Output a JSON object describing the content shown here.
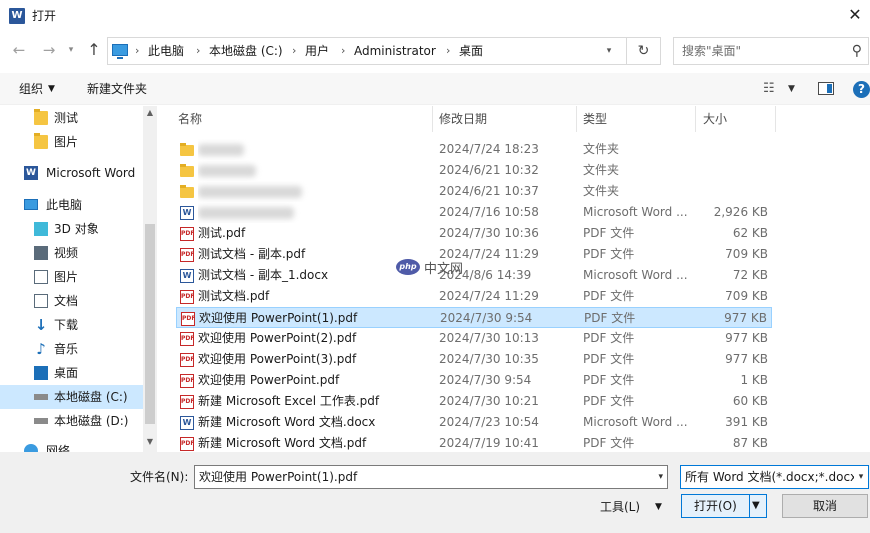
{
  "window": {
    "title": "打开",
    "app_icon": "W"
  },
  "address": {
    "crumbs": [
      "此电脑",
      "本地磁盘 (C:)",
      "用户",
      "Administrator",
      "桌面"
    ],
    "search_placeholder": "搜索\"桌面\""
  },
  "toolbar": {
    "organize_label": "组织",
    "new_folder_label": "新建文件夹"
  },
  "nav": {
    "items": [
      {
        "label": "测试",
        "icon": "folder-icon"
      },
      {
        "label": "图片",
        "icon": "folder-icon"
      },
      {
        "label": "Microsoft Word",
        "icon": "word-icon"
      },
      {
        "label": "此电脑",
        "icon": "computer-icon"
      },
      {
        "label": "3D 对象",
        "icon": "cube-icon"
      },
      {
        "label": "视频",
        "icon": "video-icon"
      },
      {
        "label": "图片",
        "icon": "picture-icon"
      },
      {
        "label": "文档",
        "icon": "document-icon"
      },
      {
        "label": "下载",
        "icon": "download-icon"
      },
      {
        "label": "音乐",
        "icon": "music-icon"
      },
      {
        "label": "桌面",
        "icon": "desktop-icon"
      },
      {
        "label": "本地磁盘 (C:)",
        "icon": "drive-icon"
      },
      {
        "label": "本地磁盘 (D:)",
        "icon": "drive-icon"
      },
      {
        "label": "网络",
        "icon": "network-icon"
      }
    ]
  },
  "columns": {
    "name": "名称",
    "date": "修改日期",
    "type": "类型",
    "size": "大小"
  },
  "files": [
    {
      "name": "",
      "date": "2024/7/24 18:23",
      "type": "文件夹",
      "size": "",
      "icon": "folder"
    },
    {
      "name": "",
      "date": "2024/6/21 10:32",
      "type": "文件夹",
      "size": "",
      "icon": "folder"
    },
    {
      "name": "",
      "date": "2024/6/21 10:37",
      "type": "文件夹",
      "size": "",
      "icon": "folder"
    },
    {
      "name": "",
      "date": "2024/7/16 10:58",
      "type": "Microsoft Word ...",
      "size": "2,926 KB",
      "icon": "word"
    },
    {
      "name": "测试.pdf",
      "date": "2024/7/30 10:36",
      "type": "PDF 文件",
      "size": "62 KB",
      "icon": "pdf"
    },
    {
      "name": "测试文档 - 副本.pdf",
      "date": "2024/7/24 11:29",
      "type": "PDF 文件",
      "size": "709 KB",
      "icon": "pdf"
    },
    {
      "name": "测试文档 - 副本_1.docx",
      "date": "2024/8/6 14:39",
      "type": "Microsoft Word ...",
      "size": "72 KB",
      "icon": "word"
    },
    {
      "name": "测试文档.pdf",
      "date": "2024/7/24 11:29",
      "type": "PDF 文件",
      "size": "709 KB",
      "icon": "pdf"
    },
    {
      "name": "欢迎使用 PowerPoint(1).pdf",
      "date": "2024/7/30 9:54",
      "type": "PDF 文件",
      "size": "977 KB",
      "icon": "pdf"
    },
    {
      "name": "欢迎使用 PowerPoint(2).pdf",
      "date": "2024/7/30 10:13",
      "type": "PDF 文件",
      "size": "977 KB",
      "icon": "pdf"
    },
    {
      "name": "欢迎使用 PowerPoint(3).pdf",
      "date": "2024/7/30 10:35",
      "type": "PDF 文件",
      "size": "977 KB",
      "icon": "pdf"
    },
    {
      "name": "欢迎使用 PowerPoint.pdf",
      "date": "2024/7/30 9:54",
      "type": "PDF 文件",
      "size": "1 KB",
      "icon": "pdf"
    },
    {
      "name": "新建 Microsoft Excel 工作表.pdf",
      "date": "2024/7/30 10:21",
      "type": "PDF 文件",
      "size": "60 KB",
      "icon": "pdf"
    },
    {
      "name": "新建 Microsoft Word 文档.docx",
      "date": "2024/7/23 10:54",
      "type": "Microsoft Word ...",
      "size": "391 KB",
      "icon": "word"
    },
    {
      "name": "新建 Microsoft Word 文档.pdf",
      "date": "2024/7/19 10:41",
      "type": "PDF 文件",
      "size": "87 KB",
      "icon": "pdf"
    }
  ],
  "bottom": {
    "filename_label": "文件名(N):",
    "filename_value": "欢迎使用 PowerPoint(1).pdf",
    "filetype_value": "所有 Word 文档(*.docx;*.docx",
    "tools_label": "工具(L)",
    "open_label": "打开(O)",
    "cancel_label": "取消"
  },
  "watermark": {
    "logo": "php",
    "text": "中文网"
  },
  "colors": {
    "selection": "#cce8ff",
    "selection_border": "#99d1ff",
    "accent": "#0078d7",
    "pdf_red": "#c62828",
    "word_blue": "#2b579a"
  }
}
